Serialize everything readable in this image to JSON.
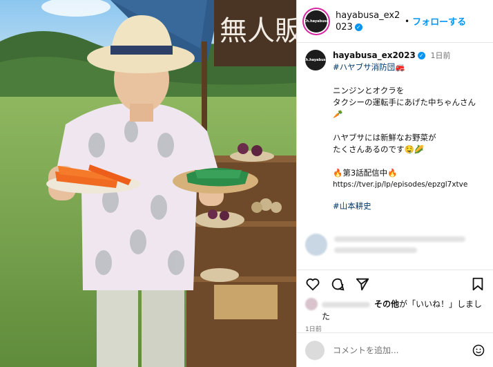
{
  "sign": {
    "text": "無人販"
  },
  "header": {
    "avatar_text": "Ch.hayabusa",
    "username": "hayabusa_ex2023",
    "verified": "✓",
    "dot": "•",
    "follow_label": "フォローする"
  },
  "caption": {
    "avatar_text": "Ch.hayabusa",
    "username": "hayabusa_ex2023",
    "verified": "✓",
    "time": "1日前",
    "hashtag1": "#ハヤブサ消防団🚒",
    "text1": "ニンジンとオクラを\nタクシーの運転手にあげた中ちゃんさん🥕",
    "text2": "ハヤブサには新鮮なお野菜が\nたくさんあるのです🤤🌽",
    "text3": "🔥第3話配信中🔥",
    "link": "https://tver.jp/lp/episodes/epzgl7xtve",
    "hashtag2": "#山本耕史"
  },
  "actions": {
    "like_icon": "heart-icon",
    "comment_icon": "comment-icon",
    "share_icon": "send-icon",
    "save_icon": "bookmark-icon",
    "likes_bold": "その他",
    "likes_rest": "が「いいね！」しました",
    "ago": "1日前"
  },
  "comment": {
    "placeholder": "コメントを追加...",
    "emoji_icon": "emoji-icon"
  },
  "colors": {
    "accent": "#0095f6",
    "link": "#00376b",
    "muted": "#737373"
  }
}
